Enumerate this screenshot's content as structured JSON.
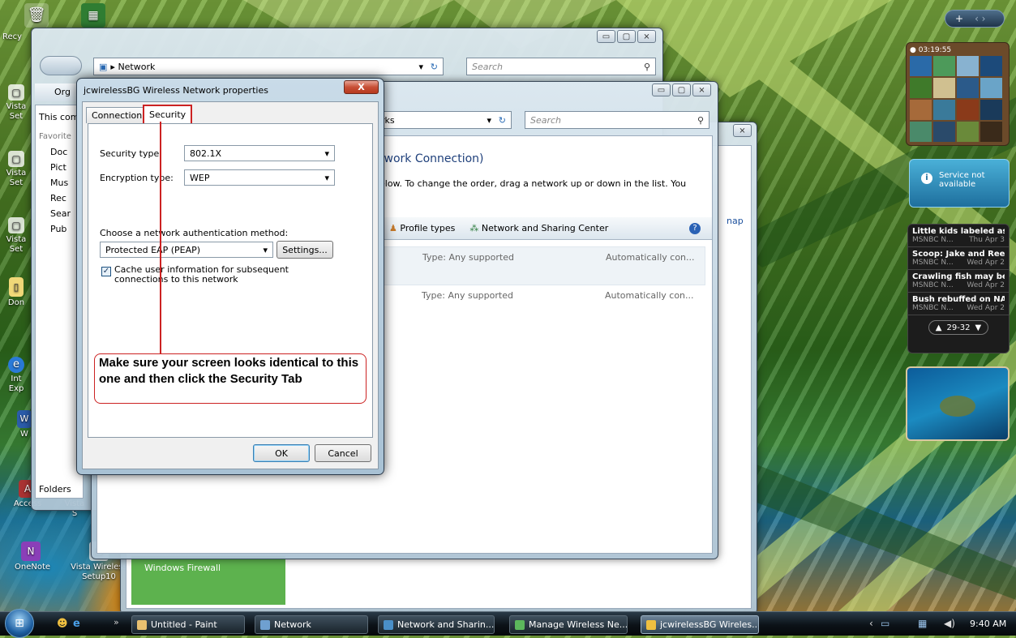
{
  "desktop": {
    "icons": [
      {
        "label": "Recy",
        "glyph": "🗑",
        "name": "recycle-bin-icon"
      },
      {
        "label": "",
        "glyph": "▦",
        "name": "excel-shortcut-icon"
      },
      {
        "label": "Vista\nSet",
        "glyph": "▢",
        "name": "vista-setup-icon-1"
      },
      {
        "label": "Vista\nSet",
        "glyph": "▢",
        "name": "vista-setup-icon-2"
      },
      {
        "label": "Vista\nSet",
        "glyph": "▢",
        "name": "vista-setup-icon-3"
      },
      {
        "label": "Don",
        "glyph": "▯",
        "name": "document-icon"
      },
      {
        "label": "Int\nExp",
        "glyph": "e",
        "name": "internet-explorer-icon"
      },
      {
        "label": "W",
        "glyph": "W",
        "name": "word-icon"
      },
      {
        "label": "Access",
        "glyph": "A",
        "name": "access-icon"
      },
      {
        "label": "Vista\nS",
        "glyph": "▢",
        "name": "vista-setup-icon-4"
      },
      {
        "label": "OneNote",
        "glyph": "N",
        "name": "onenote-icon"
      },
      {
        "label": "Vista Wireless\nSetup10",
        "glyph": "▢",
        "name": "vista-wireless-setup-icon"
      }
    ]
  },
  "network_window": {
    "address": "Network",
    "search_placeholder": "Search",
    "organize": "Org",
    "this_computer": "This com",
    "favorites_label": "Favorite",
    "favorites": [
      "Doc",
      "Pict",
      "Mus",
      "Rec",
      "Sear",
      "Pub"
    ],
    "folders_label": "Folders"
  },
  "wireless_window": {
    "address": "rks",
    "search_placeholder": "Search",
    "heading": "twork Connection)",
    "description": "elow. To change the order, drag a network up or down in the list. You",
    "toolbar": {
      "profile_types": "Profile types",
      "sharing_center": "Network and Sharing Center"
    },
    "networks": [
      {
        "type": "Type: Any supported",
        "mode": "Automatically con..."
      },
      {
        "type": "Type: Any supported",
        "mode": "Automatically con..."
      }
    ]
  },
  "back_window": {
    "map_fragment": "nap",
    "firewall": "Windows Firewall"
  },
  "dialog": {
    "title": "jcwirelessBG Wireless Network properties",
    "close": "X",
    "tabs": [
      "Connection",
      "Security"
    ],
    "security_type_label": "Security type:",
    "security_type_value": "802.1X",
    "encryption_type_label": "Encryption type:",
    "encryption_type_value": "WEP",
    "auth_method_label": "Choose a network authentication method:",
    "auth_method_value": "Protected EAP (PEAP)",
    "settings_button": "Settings...",
    "cache_checkbox_label": "Cache user information for subsequent connections to this network",
    "cache_checked": true,
    "ok": "OK",
    "cancel": "Cancel"
  },
  "callout": {
    "text": "Make sure your screen looks identical to this one and then click the Security Tab"
  },
  "sidebar": {
    "clock": "03:19:55",
    "weather": "Service not available",
    "news": [
      {
        "headline": "Little kids labeled as ...",
        "source": "MSNBC N...",
        "date": "Thu Apr 3"
      },
      {
        "headline": "Scoop: Jake and Ree...",
        "source": "MSNBC N...",
        "date": "Wed Apr 2"
      },
      {
        "headline": "Crawling fish may be...",
        "source": "MSNBC N...",
        "date": "Wed Apr 2"
      },
      {
        "headline": "Bush rebuffed on NA...",
        "source": "MSNBC N...",
        "date": "Wed Apr 2"
      }
    ],
    "news_pager": "29-32",
    "add_gadget": "+"
  },
  "taskbar": {
    "buttons": [
      {
        "label": "Untitled - Paint",
        "color": "#e8c070"
      },
      {
        "label": "Network",
        "color": "#6fa0d0"
      },
      {
        "label": "Network and Sharin...",
        "color": "#4a8fc7"
      },
      {
        "label": "Manage Wireless Ne...",
        "color": "#5cb85c"
      },
      {
        "label": "jcwirelessBG Wireles...",
        "color": "#f0c040"
      }
    ],
    "clock": "9:40 AM"
  }
}
